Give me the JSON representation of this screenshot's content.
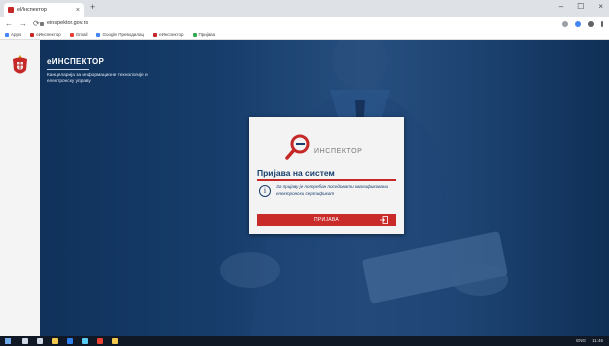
{
  "browser": {
    "tab_title": "eИнспектор",
    "tab_close": "×",
    "new_tab": "+",
    "window_controls": {
      "minimize": "–",
      "maximize": "☐",
      "close": "×"
    },
    "nav": {
      "back": "←",
      "forward": "→",
      "reload": "⟳"
    },
    "url": "einspektor.gov.rs",
    "bookmarks": [
      {
        "label": "Apps",
        "color": "#4285f4"
      },
      {
        "label": "eИнспектор",
        "color": "#c62828"
      },
      {
        "label": "Gmail",
        "color": "#ea4335"
      },
      {
        "label": "Google Преводилац",
        "color": "#4285f4"
      },
      {
        "label": "eИнспектор",
        "color": "#c62828"
      },
      {
        "label": "Пријава",
        "color": "#34a853"
      }
    ]
  },
  "brand": {
    "title": "еИНСПЕКТОР",
    "subtitle": "Канцеларија за информационе технологије и електронску управу"
  },
  "login": {
    "logo_text": "ИНСПЕКТОР",
    "title": "Пријава на систем",
    "info": "За пријаву је потребан поседовати квалификовани електронски сертификат",
    "button": "ПРИЈАВА"
  },
  "taskbar": {
    "icons": [
      {
        "name": "search-icon",
        "color": "#cfd8e3"
      },
      {
        "name": "task-view-icon",
        "color": "#cfd8e3"
      },
      {
        "name": "file-explorer-icon",
        "color": "#f2c94c"
      },
      {
        "name": "edge-icon",
        "color": "#2f80ed"
      },
      {
        "name": "store-icon",
        "color": "#56ccf2"
      },
      {
        "name": "chrome-icon",
        "color": "#e94235"
      },
      {
        "name": "folder-icon",
        "color": "#f2c94c"
      }
    ],
    "time": "11:46",
    "lang": "ENG"
  }
}
